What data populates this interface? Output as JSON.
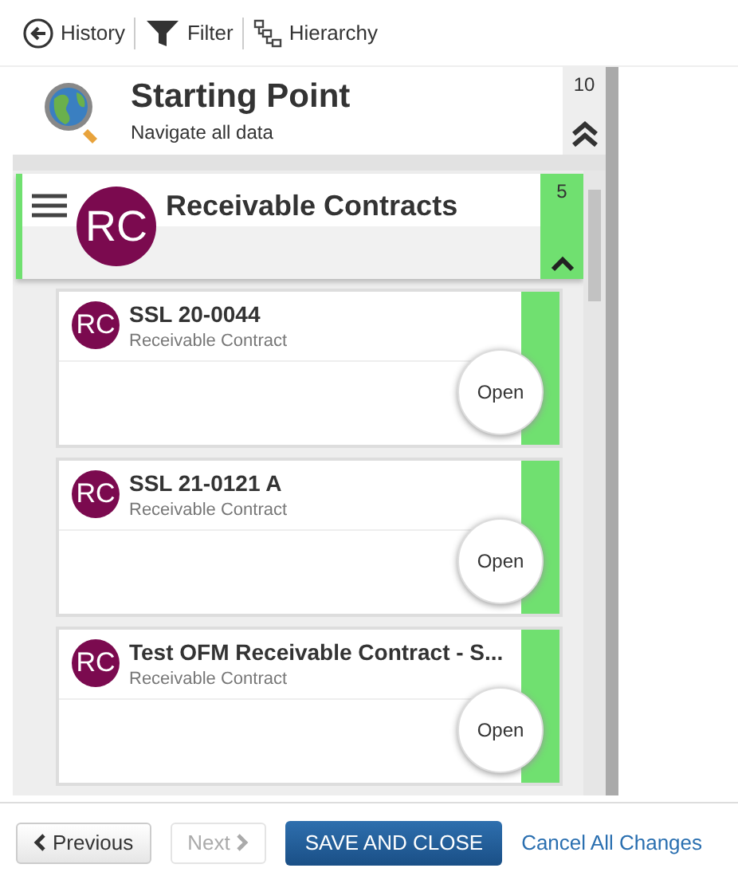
{
  "toolbar": [
    {
      "kind": "history",
      "label": "History"
    },
    {
      "kind": "filter",
      "label": "Filter"
    },
    {
      "kind": "hierarchy",
      "label": "Hierarchy"
    }
  ],
  "starting_point": {
    "title": "Starting Point",
    "subtitle": "Navigate all data",
    "count": "10"
  },
  "group": {
    "title": "Receivable Contracts",
    "initials": "RC",
    "count": "5",
    "expanded": true
  },
  "records": [
    {
      "initials": "RC",
      "title": "SSL 20-0044",
      "type": "Receivable Contract",
      "action": "Open"
    },
    {
      "initials": "RC",
      "title": "SSL 21-0121 A",
      "type": "Receivable Contract",
      "action": "Open"
    },
    {
      "initials": "RC",
      "title": "Test OFM Receivable Contract - S...",
      "type": "Receivable Contract",
      "action": "Open"
    }
  ],
  "footer": [
    {
      "kind": "previous",
      "label": "Previous",
      "disabled": false
    },
    {
      "kind": "next",
      "label": "Next",
      "disabled": true
    },
    {
      "kind": "primary",
      "label": "SAVE AND CLOSE",
      "disabled": false
    },
    {
      "kind": "link",
      "label": "Cancel All Changes",
      "disabled": false
    }
  ]
}
